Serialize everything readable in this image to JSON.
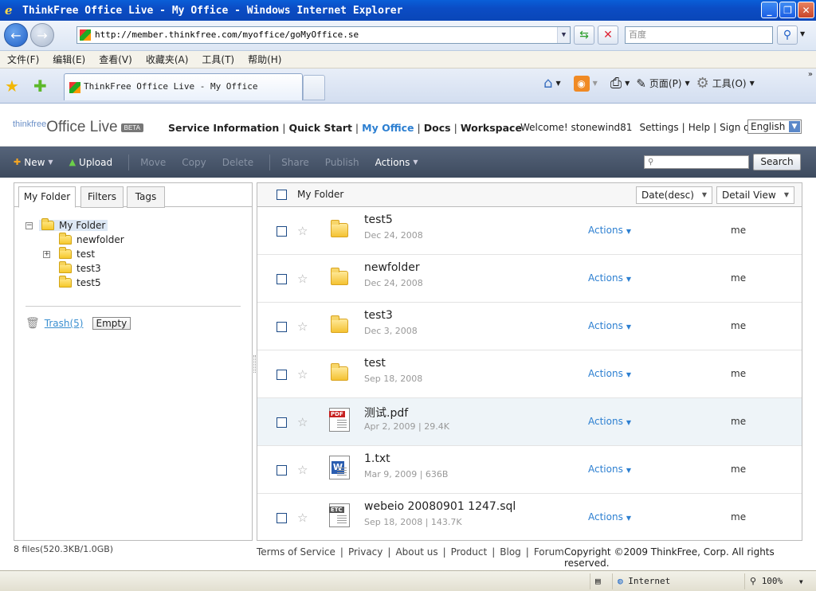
{
  "window": {
    "title": "ThinkFree Office Live - My Office - Windows Internet Explorer",
    "minimize": "_",
    "restore": "❐",
    "close": "✕"
  },
  "browser": {
    "url": "http://member.thinkfree.com/myoffice/goMyOffice.se",
    "search_placeholder": "百度",
    "menu": [
      "文件(F)",
      "编辑(E)",
      "查看(V)",
      "收藏夹(A)",
      "工具(T)",
      "帮助(H)"
    ],
    "tab_title": "ThinkFree Office Live - My Office",
    "cmd_page": "页面(P)",
    "cmd_tools": "工具(O)",
    "status_zone": "Internet",
    "zoom": "100%"
  },
  "app": {
    "logo_think": "thinkfree",
    "logo_office": "Office Live",
    "logo_beta": "BETA",
    "nav": {
      "service": "Service Information",
      "quickstart": "Quick Start",
      "myoffice": "My Office",
      "docs": "Docs",
      "workspace": "Workspace"
    },
    "welcome": "Welcome! stonewind81",
    "settings": "Settings",
    "help": "Help",
    "signout": "Sign out",
    "language": "English",
    "toolbar": {
      "new": "New",
      "upload": "Upload",
      "move": "Move",
      "copy": "Copy",
      "delete": "Delete",
      "share": "Share",
      "publish": "Publish",
      "actions": "Actions",
      "search_btn": "Search"
    },
    "left": {
      "tabs": [
        "My Folder",
        "Filters",
        "Tags"
      ],
      "tree_root": "My Folder",
      "tree": [
        "newfolder",
        "test",
        "test3",
        "test5"
      ],
      "trash": "Trash(5)",
      "empty": "Empty"
    },
    "right": {
      "header": "My Folder",
      "sort": "Date(desc)",
      "view": "Detail View",
      "files": [
        {
          "name": "test5",
          "meta": "Dec 24, 2008",
          "type": "folder",
          "actions": "Actions",
          "owner": "me"
        },
        {
          "name": "newfolder",
          "meta": "Dec 24, 2008",
          "type": "folder",
          "actions": "Actions",
          "owner": "me"
        },
        {
          "name": "test3",
          "meta": "Dec 3, 2008",
          "type": "folder",
          "actions": "Actions",
          "owner": "me"
        },
        {
          "name": "test",
          "meta": "Sep 18, 2008",
          "type": "folder",
          "actions": "Actions",
          "owner": "me"
        },
        {
          "name": "测试.pdf",
          "meta": "Apr 2, 2009 | 29.4K",
          "type": "pdf",
          "actions": "Actions",
          "owner": "me"
        },
        {
          "name": "1.txt",
          "meta": "Mar 9, 2009 | 636B",
          "type": "word",
          "actions": "Actions",
          "owner": "me"
        },
        {
          "name": "webeio 20080901 1247.sql",
          "meta": "Sep 18, 2008 | 143.7K",
          "type": "etc",
          "actions": "Actions",
          "owner": "me"
        }
      ]
    },
    "storage": "8 files(520.3KB/1.0GB)",
    "footer": [
      "Terms of Service",
      "Privacy",
      "About us",
      "Product",
      "Blog",
      "Forum"
    ],
    "copyright": "Copyright ©2009 ThinkFree, Corp. All rights reserved."
  }
}
